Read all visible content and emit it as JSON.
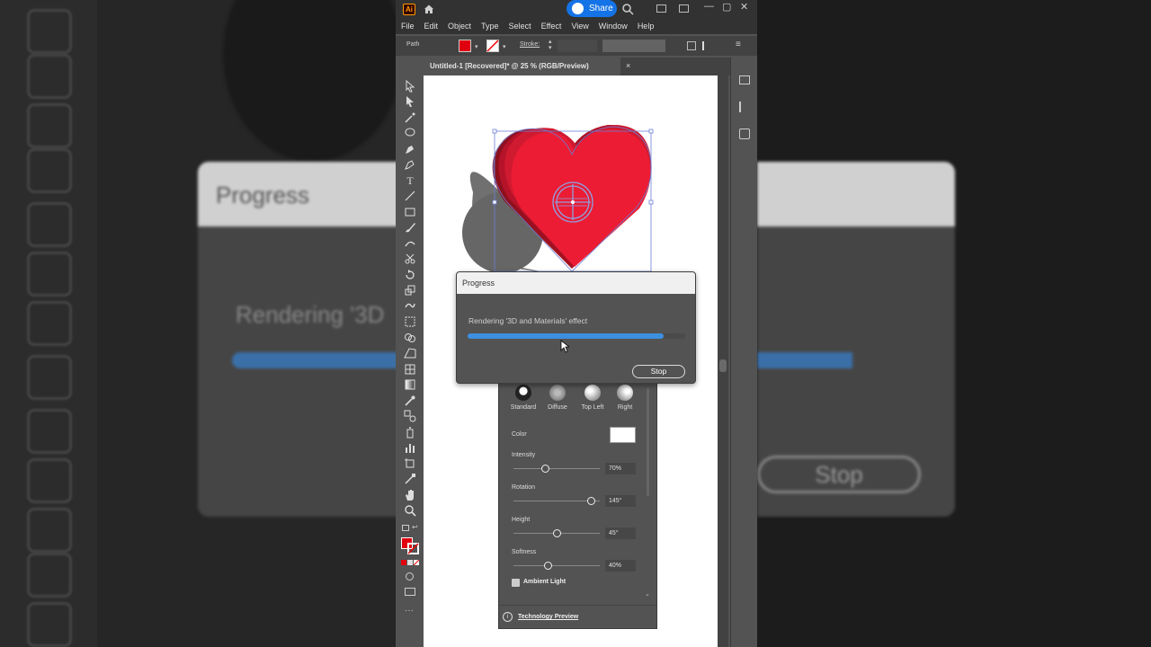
{
  "app": {
    "logo": "Ai",
    "share_label": "Share"
  },
  "menu": [
    "File",
    "Edit",
    "Object",
    "Type",
    "Select",
    "Effect",
    "View",
    "Window",
    "Help"
  ],
  "control_bar": {
    "selection_type": "Path",
    "stroke_label": "Stroke:"
  },
  "document_tab": {
    "title": "Untitled-1 [Recovered]* @ 25 % (RGB/Preview)",
    "close": "×"
  },
  "progress_dialog": {
    "title": "Progress",
    "message": "Rendering '3D and Materials' effect",
    "progress_fraction": 0.9,
    "stop_label": "Stop"
  },
  "lighting_panel": {
    "presets": [
      "Standard",
      "Diffuse",
      "Top Left",
      "Right"
    ],
    "color_label": "Color",
    "intensity_label": "Intensity",
    "intensity_value": "70%",
    "intensity_fraction": 0.37,
    "rotation_label": "Rotation",
    "rotation_value": "145°",
    "rotation_fraction": 0.9,
    "height_label": "Height",
    "height_value": "45°",
    "height_fraction": 0.5,
    "softness_label": "Softness",
    "softness_value": "40%",
    "softness_fraction": 0.4,
    "ambient_label": "Ambient Light",
    "tech_preview_label": "Technology Preview"
  },
  "background": {
    "dialog_title": "Progress",
    "rendering_text": "Rendering '3D",
    "stop_label": "Stop"
  },
  "colors": {
    "accent": "#1473e6",
    "progress_fill": "#3d8fe0",
    "heart": "#e8192c",
    "selection": "#6b7fd4"
  }
}
